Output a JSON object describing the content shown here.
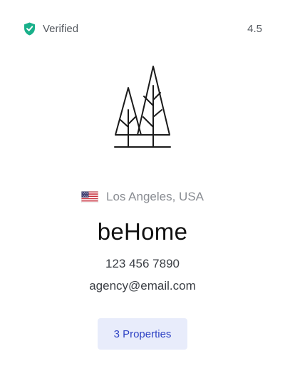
{
  "header": {
    "verified_label": "Verified",
    "verified_icon": "shield-check-icon",
    "rating": "4.5"
  },
  "logo": {
    "icon": "trees-logo-icon"
  },
  "location": {
    "flag_icon": "usa-flag-icon",
    "text": "Los Angeles, USA"
  },
  "agency": {
    "name": "beHome",
    "phone": "123 456 7890",
    "email": "agency@email.com"
  },
  "actions": {
    "properties_label": "3 Properties"
  },
  "colors": {
    "verified_green": "#19b08a",
    "accent_blue": "#2f43c4",
    "button_bg": "#e8ecfb"
  }
}
